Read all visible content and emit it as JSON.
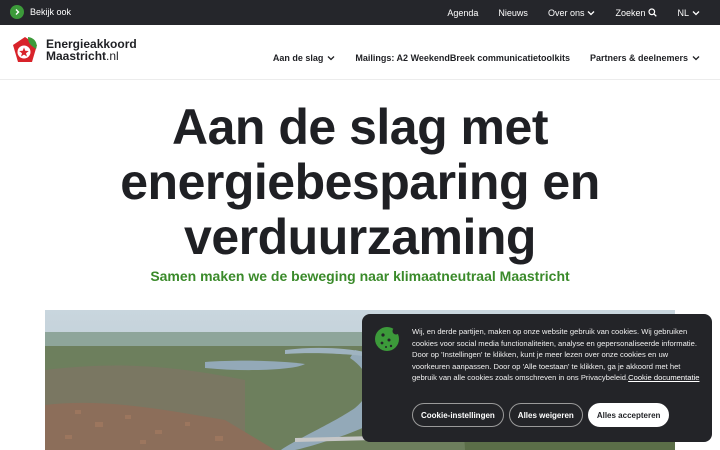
{
  "topbar": {
    "bekijk_ook": "Bekijk ook",
    "links": {
      "agenda": "Agenda",
      "nieuws": "Nieuws",
      "over_ons": "Over ons",
      "zoeken": "Zoeken",
      "lang": "NL"
    }
  },
  "logo": {
    "line1": "Energieakkoord",
    "line2_main": "Maastricht",
    "line2_suffix": ".nl"
  },
  "nav": {
    "aan_de_slag": "Aan de slag",
    "mailings": "Mailings: A2 WeekendBreek communicatietoolkits",
    "partners": "Partners & deelnemers"
  },
  "hero": {
    "title_line1": "Aan de slag met",
    "title_line2": "energiebesparing en",
    "title_line3": "verduurzaming",
    "subtitle": "Samen maken we de beweging naar klimaatneutraal Maastricht"
  },
  "cookie": {
    "message": "Wij, en derde partijen, maken op onze website gebruik van cookies. Wij gebruiken cookies voor social media functionaliteiten, analyse en gepersonaliseerde informatie. Door op 'Instellingen' te klikken, kunt je meer lezen over onze cookies en uw voorkeuren aanpassen. Door op 'Alle toestaan' te klikken, ga je akkoord met het gebruik van alle cookies zoals omschreven in ons Privacybeleid.",
    "link": "Cookie documentatie",
    "btn_settings": "Cookie-instellingen",
    "btn_reject": "Alles weigeren",
    "btn_accept": "Alles accepteren"
  },
  "colors": {
    "topbar": "#25262b",
    "accent_green": "#3a8a2a",
    "logo_red": "#d8232a"
  },
  "icons": {
    "bekijk": "chevron-right-icon",
    "dropdown": "chevron-down-icon",
    "search": "search-icon",
    "cookie": "cookie-icon"
  }
}
